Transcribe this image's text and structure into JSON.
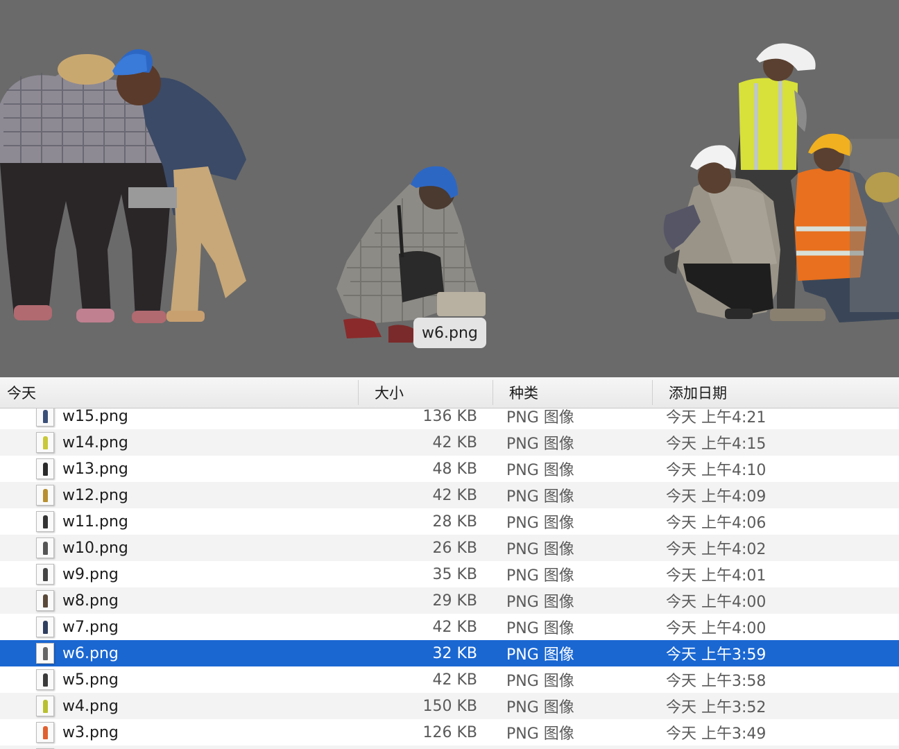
{
  "preview": {
    "filename_tooltip": "w6.png"
  },
  "columns": {
    "name": "今天",
    "size": "大小",
    "kind": "种类",
    "date_added": "添加日期"
  },
  "colors": {
    "selection": "#1a67d2",
    "preview_background": "#6a6a6a"
  },
  "files": [
    {
      "name": "w15.png",
      "size": "136 KB",
      "kind": "PNG 图像",
      "date": "今天 上午4:21",
      "thumb_color": "#3a4f78"
    },
    {
      "name": "w14.png",
      "size": "42 KB",
      "kind": "PNG 图像",
      "date": "今天 上午4:15",
      "thumb_color": "#c8c83a"
    },
    {
      "name": "w13.png",
      "size": "48 KB",
      "kind": "PNG 图像",
      "date": "今天 上午4:10",
      "thumb_color": "#2a2a2a"
    },
    {
      "name": "w12.png",
      "size": "42 KB",
      "kind": "PNG 图像",
      "date": "今天 上午4:09",
      "thumb_color": "#b89030"
    },
    {
      "name": "w11.png",
      "size": "28 KB",
      "kind": "PNG 图像",
      "date": "今天 上午4:06",
      "thumb_color": "#333333"
    },
    {
      "name": "w10.png",
      "size": "26 KB",
      "kind": "PNG 图像",
      "date": "今天 上午4:02",
      "thumb_color": "#555555"
    },
    {
      "name": "w9.png",
      "size": "35 KB",
      "kind": "PNG 图像",
      "date": "今天 上午4:01",
      "thumb_color": "#444444"
    },
    {
      "name": "w8.png",
      "size": "29 KB",
      "kind": "PNG 图像",
      "date": "今天 上午4:00",
      "thumb_color": "#5a4a3a"
    },
    {
      "name": "w7.png",
      "size": "42 KB",
      "kind": "PNG 图像",
      "date": "今天 上午4:00",
      "thumb_color": "#2f3f5f"
    },
    {
      "name": "w6.png",
      "size": "32 KB",
      "kind": "PNG 图像",
      "date": "今天 上午3:59",
      "thumb_color": "#666666",
      "selected": true
    },
    {
      "name": "w5.png",
      "size": "42 KB",
      "kind": "PNG 图像",
      "date": "今天 上午3:58",
      "thumb_color": "#3a3a3a"
    },
    {
      "name": "w4.png",
      "size": "150 KB",
      "kind": "PNG 图像",
      "date": "今天 上午3:52",
      "thumb_color": "#b8c030"
    },
    {
      "name": "w3.png",
      "size": "126 KB",
      "kind": "PNG 图像",
      "date": "今天 上午3:49",
      "thumb_color": "#e06030"
    },
    {
      "name": "",
      "size": "",
      "kind": "",
      "date": "",
      "thumb_color": "#888888"
    }
  ]
}
